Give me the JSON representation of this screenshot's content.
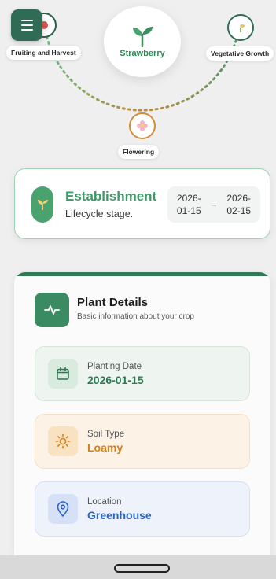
{
  "lifecycle": {
    "crop_name": "Strawberry",
    "stages": {
      "left": "Fruiting and Harvest",
      "right": "Vegetative Growth",
      "bottom": "Flowering"
    }
  },
  "current_stage": {
    "title": "Establishment",
    "subtitle": "Lifecycle stage.",
    "start_date_line1": "2026-",
    "start_date_line2": "01-15",
    "end_date_line1": "2026-",
    "end_date_line2": "02-15",
    "arrow": "→"
  },
  "plant_details": {
    "title": "Plant Details",
    "subtitle": "Basic information about your crop",
    "items": [
      {
        "label": "Planting Date",
        "value": "2026-01-15",
        "icon": "calendar-icon",
        "color": "#2c7a52"
      },
      {
        "label": "Soil Type",
        "value": "Loamy",
        "icon": "sun-icon",
        "color": "#d98018"
      },
      {
        "label": "Location",
        "value": "Greenhouse",
        "icon": "location-pin-icon",
        "color": "#2c63c6"
      }
    ]
  },
  "colors": {
    "accent_green": "#2f7a55",
    "stage_green": "#3d9a68"
  }
}
